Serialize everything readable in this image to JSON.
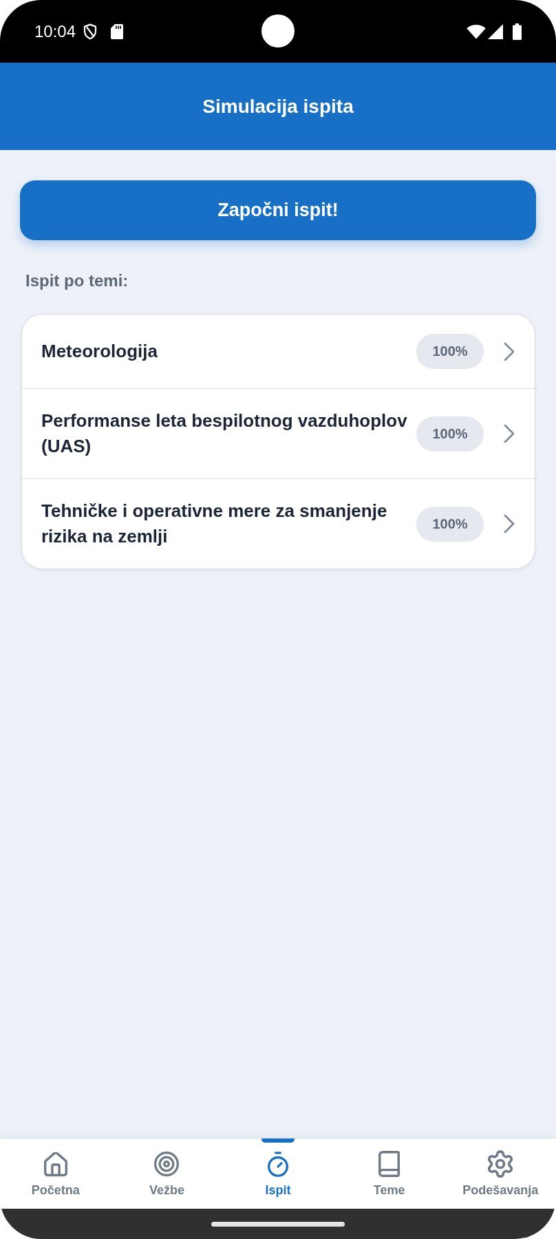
{
  "status_bar": {
    "time": "10:04"
  },
  "app_bar": {
    "title": "Simulacija ispita"
  },
  "start_button": {
    "label": "Započni ispit!"
  },
  "topics_section": {
    "title": "Ispit po temi:",
    "items": [
      {
        "title": "Meteorologija",
        "score": "100%"
      },
      {
        "title": "Performanse leta bespilotnog vazduhoplov (UAS)",
        "score": "100%"
      },
      {
        "title": "Tehničke i operativne mere za smanjenje rizika na zemlji",
        "score": "100%"
      }
    ]
  },
  "bottom_nav": [
    {
      "label": "Početna",
      "selected": false
    },
    {
      "label": "Vežbe",
      "selected": false
    },
    {
      "label": "Ispit",
      "selected": true
    },
    {
      "label": "Teme",
      "selected": false
    },
    {
      "label": "Podešavanja",
      "selected": false
    }
  ]
}
